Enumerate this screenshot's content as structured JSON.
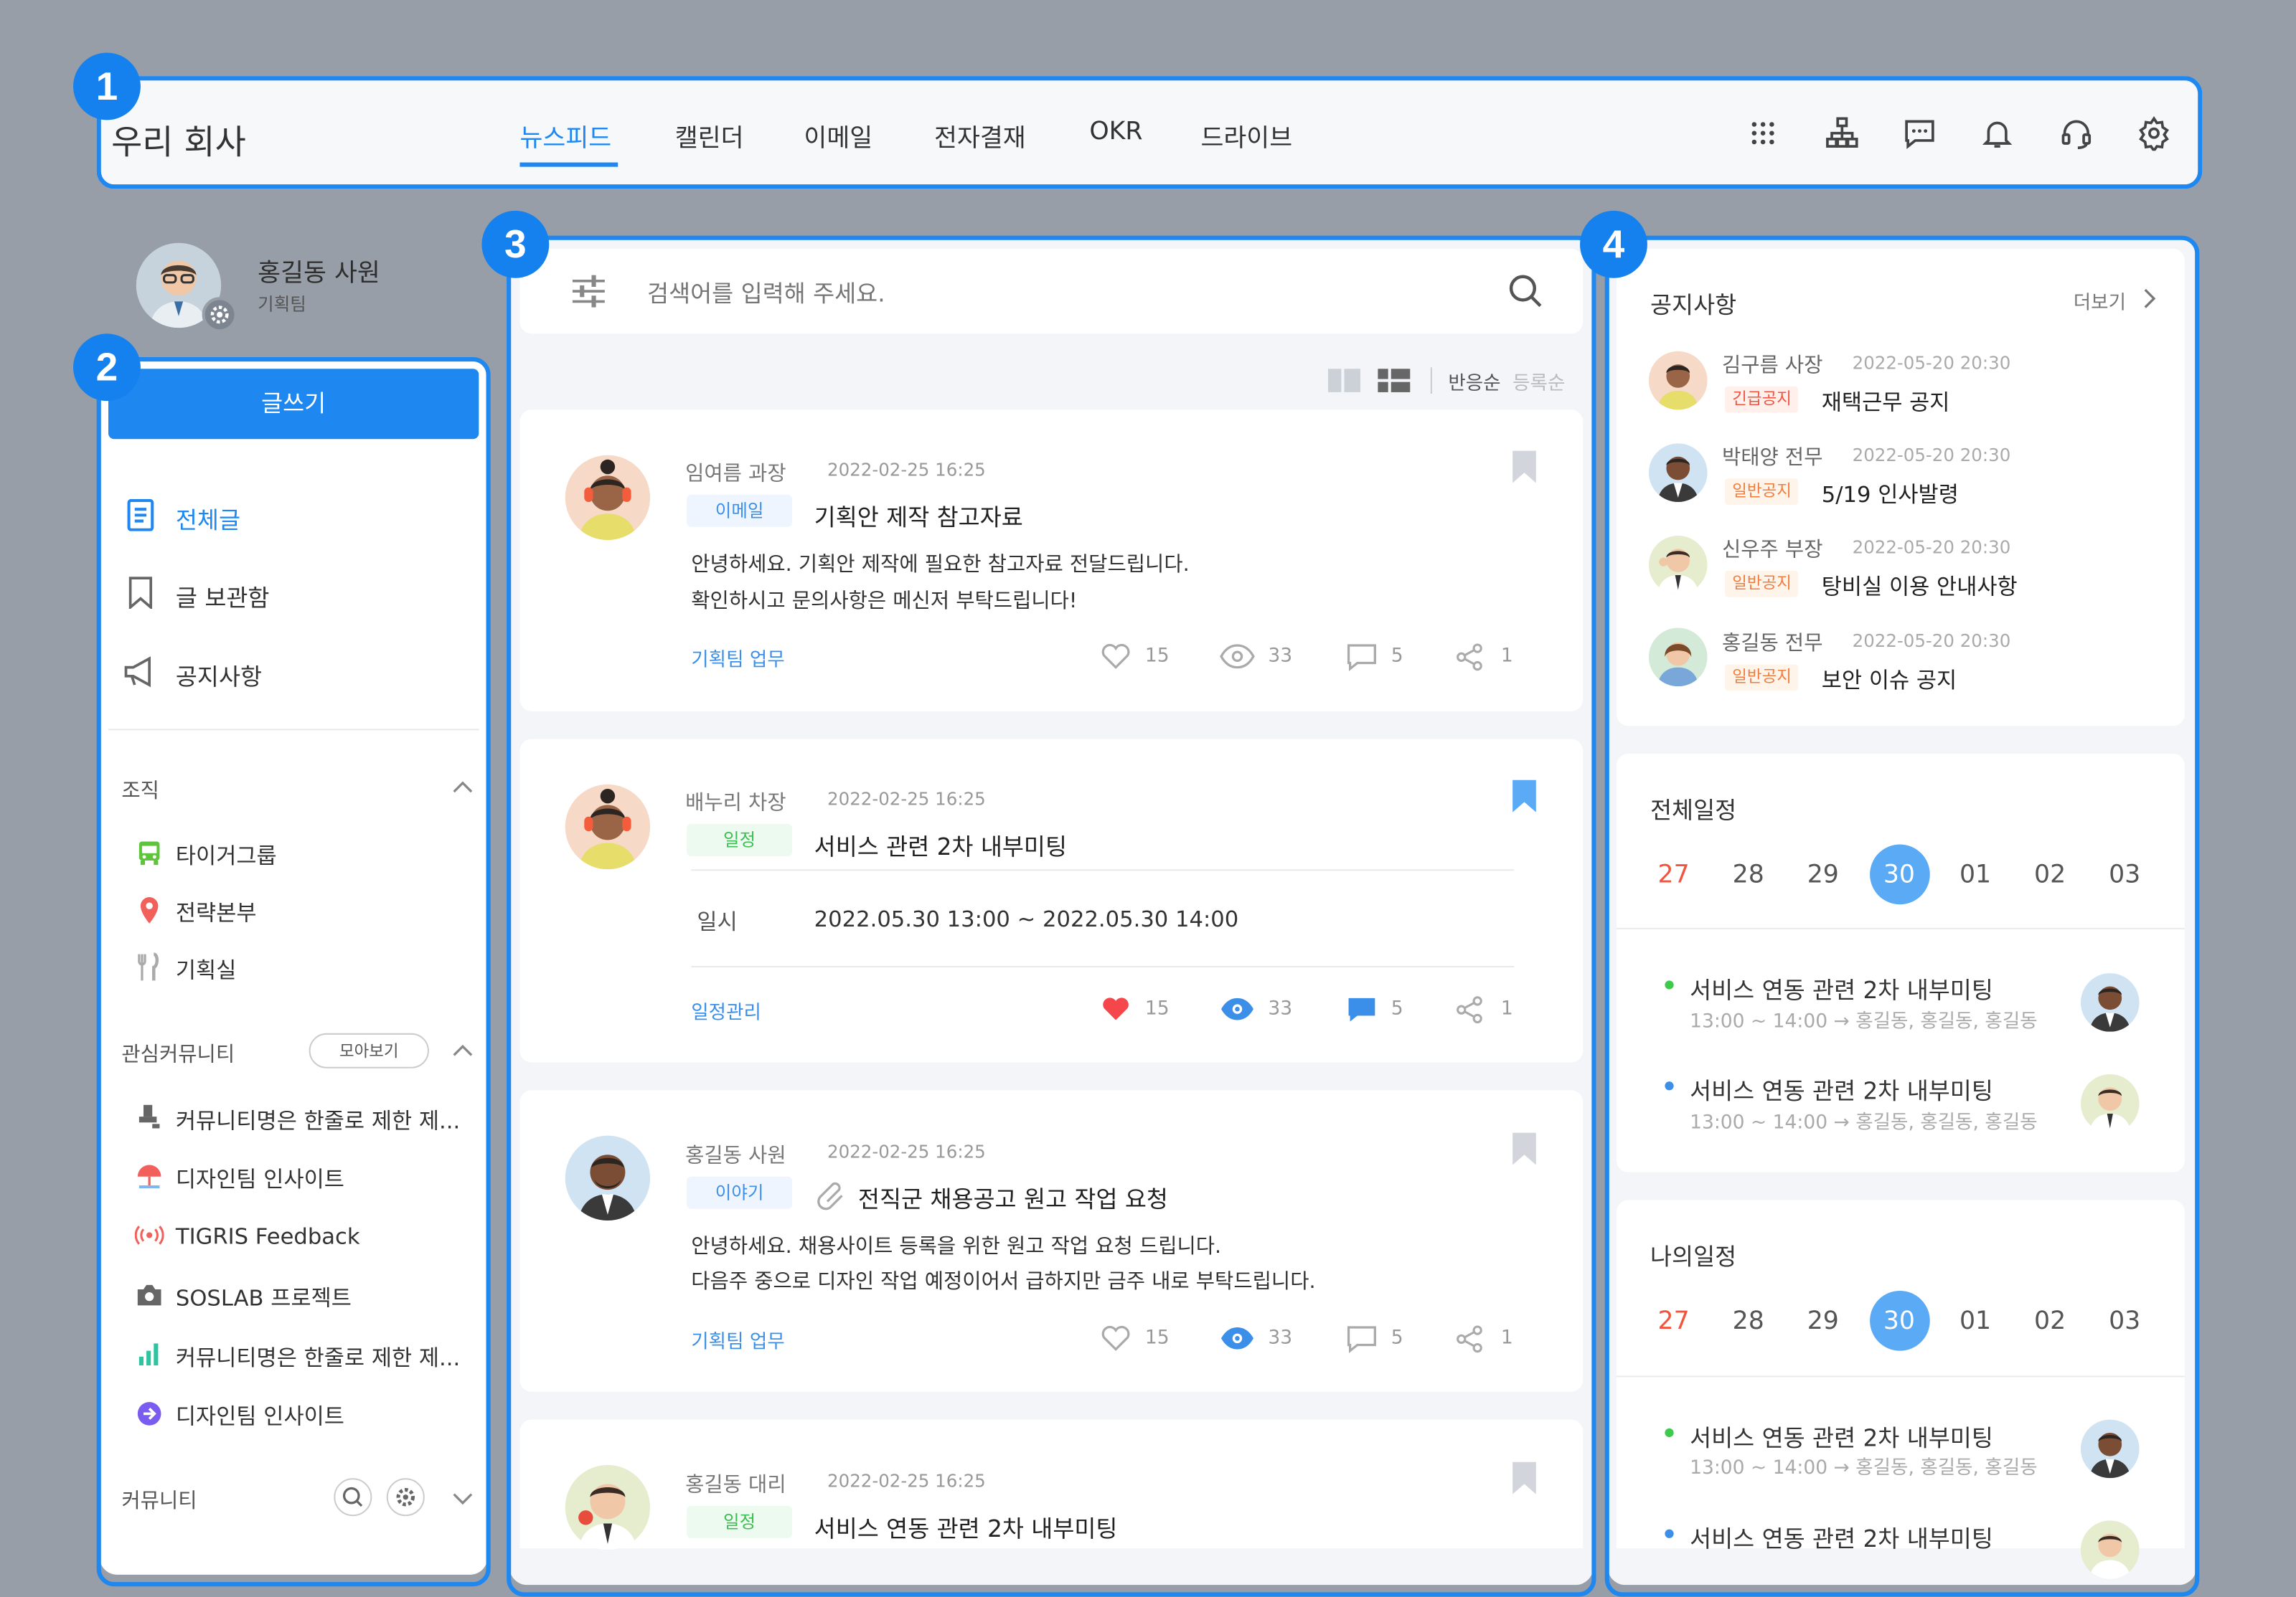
{
  "header": {
    "company": "우리 회사",
    "tabs": [
      {
        "label": "뉴스피드",
        "active": true
      },
      {
        "label": "캘린더"
      },
      {
        "label": "이메일"
      },
      {
        "label": "전자결재"
      },
      {
        "label": "OKR"
      },
      {
        "label": "드라이브"
      }
    ],
    "icons": [
      "apps-grid-icon",
      "org-chart-icon",
      "chat-icon",
      "bell-icon",
      "headset-icon",
      "settings-icon"
    ]
  },
  "markers": [
    "1",
    "2",
    "3",
    "4"
  ],
  "profile": {
    "name": "홍길동 사원",
    "team": "기획팀"
  },
  "sidebar": {
    "write_button": "글쓰기",
    "nav": [
      {
        "label": "전체글",
        "icon": "document-icon",
        "active": true
      },
      {
        "label": "글 보관함",
        "icon": "bookmark-icon"
      },
      {
        "label": "공지사항",
        "icon": "megaphone-icon"
      }
    ],
    "org_section": {
      "title": "조직",
      "items": [
        {
          "label": "타이거그룹",
          "icon": "bus-icon"
        },
        {
          "label": "전략본부",
          "icon": "map-pin-icon"
        },
        {
          "label": "기획실",
          "icon": "utensils-icon"
        }
      ]
    },
    "community_section": {
      "title": "관심커뮤니티",
      "more_button": "모아보기",
      "items": [
        {
          "label": "커뮤니티명은 한줄로 제한 제...",
          "icon": "stamp-icon"
        },
        {
          "label": "디자인팀 인사이트",
          "icon": "umbrella-icon"
        },
        {
          "label": "TIGRIS Feedback",
          "icon": "broadcast-icon"
        },
        {
          "label": "SOSLAB 프로젝트",
          "icon": "camera-icon"
        },
        {
          "label": "커뮤니티명은 한줄로 제한 제...",
          "icon": "bar-chart-icon"
        },
        {
          "label": "디자인팀 인사이트",
          "icon": "arrow-circle-icon"
        }
      ]
    },
    "all_community_title": "커뮤니티"
  },
  "feed": {
    "search_placeholder": "검색어를 입력해 주세요.",
    "sort_options": [
      "반응순",
      "등록순"
    ],
    "posts": [
      {
        "author": "임여름 과장",
        "date": "2022-02-25 16:25",
        "tag": "이메일",
        "title": "기획안 제작 참고자료",
        "body": [
          "안녕하세요. 기획안 제작에 필요한 참고자료 전달드립니다.",
          "확인하시고 문의사항은 메신저 부탁드립니다!"
        ],
        "category": "기획팀 업무",
        "likes": "15",
        "views": "33",
        "comments": "5",
        "shares": "1"
      },
      {
        "author": "배누리 차장",
        "date": "2022-02-25 16:25",
        "tag": "일정",
        "title": "서비스 관련 2차 내부미팅",
        "schedule_label": "일시",
        "schedule_value": "2022.05.30 13:00 ~ 2022.05.30 14:00",
        "category": "일정관리",
        "likes": "15",
        "views": "33",
        "comments": "5",
        "shares": "1"
      },
      {
        "author": "홍길동 사원",
        "date": "2022-02-25 16:25",
        "tag": "이야기",
        "title": "전직군 채용공고 원고 작업 요청",
        "body": [
          "안녕하세요. 채용사이트 등록을 위한 원고 작업 요청 드립니다.",
          "다음주 중으로 디자인 작업 예정이어서 급하지만 금주 내로 부탁드립니다."
        ],
        "category": "기획팀 업무",
        "likes": "15",
        "views": "33",
        "comments": "5",
        "shares": "1"
      },
      {
        "author": "홍길동 대리",
        "date": "2022-02-25 16:25",
        "tag": "일정",
        "title": "서비스 연동 관련 2차 내부미팅"
      }
    ]
  },
  "right": {
    "notices": {
      "title": "공지사항",
      "more": "더보기",
      "items": [
        {
          "name": "김구름 사장",
          "date": "2022-05-20 20:30",
          "tag": "긴급공지",
          "title": "재택근무 공지"
        },
        {
          "name": "박태양 전무",
          "date": "2022-05-20 20:30",
          "tag": "일반공지",
          "title": "5/19 인사발령"
        },
        {
          "name": "신우주 부장",
          "date": "2022-05-20 20:30",
          "tag": "일반공지",
          "title": "탕비실 이용 안내사항"
        },
        {
          "name": "홍길동 전무",
          "date": "2022-05-20 20:30",
          "tag": "일반공지",
          "title": "보안 이슈 공지"
        }
      ]
    },
    "all_schedule": {
      "title": "전체일정",
      "days": [
        "27",
        "28",
        "29",
        "30",
        "01",
        "02",
        "03"
      ],
      "events": [
        {
          "title": "서비스 연동 관련 2차 내부미팅",
          "time": "13:00 ~ 14:00",
          "attendees": "홍길동, 홍길동, 홍길동",
          "dot": "#3ccb4b"
        },
        {
          "title": "서비스 연동 관련 2차 내부미팅",
          "time": "13:00 ~ 14:00",
          "attendees": "홍길동, 홍길동, 홍길동",
          "dot": "#3b8fe8"
        }
      ]
    },
    "my_schedule": {
      "title": "나의일정",
      "days": [
        "27",
        "28",
        "29",
        "30",
        "01",
        "02",
        "03"
      ],
      "events": [
        {
          "title": "서비스 연동 관련 2차 내부미팅",
          "time": "13:00 ~ 14:00",
          "attendees": "홍길동, 홍길동, 홍길동",
          "dot": "#3ccb4b"
        },
        {
          "title": "서비스 연동 관련 2차 내부미팅",
          "dot": "#3b8fe8"
        }
      ]
    }
  },
  "colors": {
    "accent": "#1e88f0",
    "background": "#979ea7",
    "selected_day": "#5aaaf5",
    "sunday": "#f2543f",
    "heart": "#f5474b"
  }
}
